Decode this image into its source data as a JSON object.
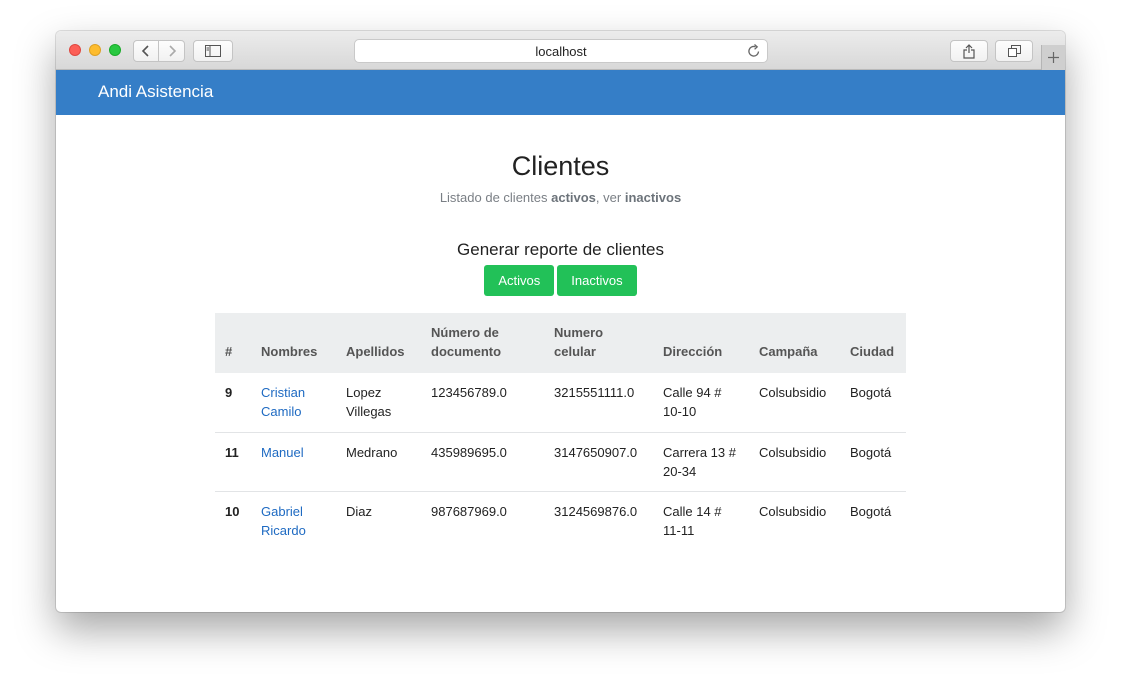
{
  "browser": {
    "url": "localhost"
  },
  "navbar": {
    "brand": "Andi Asistencia",
    "color": "#357ec7"
  },
  "page": {
    "title": "Clientes",
    "subtitle_prefix": "Listado de clientes ",
    "subtitle_active": "activos",
    "subtitle_mid": ", ver ",
    "subtitle_inactive": "inactivos",
    "report_heading": "Generar reporte de clientes",
    "btn_active": "Activos",
    "btn_inactive": "Inactivos",
    "button_color": "#22c158"
  },
  "table": {
    "headers": [
      "#",
      "Nombres",
      "Apellidos",
      "Número de documento",
      "Numero celular",
      "Dirección",
      "Campaña",
      "Ciudad"
    ],
    "rows": [
      {
        "id": "9",
        "nombres": "Cristian Camilo",
        "apellidos": "Lopez Villegas",
        "documento": "123456789.0",
        "celular": "3215551111.0",
        "direccion": "Calle 94 # 10-10",
        "campana": "Colsubsidio",
        "ciudad": "Bogotá"
      },
      {
        "id": "11",
        "nombres": "Manuel",
        "apellidos": "Medrano",
        "documento": "435989695.0",
        "celular": "3147650907.0",
        "direccion": "Carrera 13 # 20-34",
        "campana": "Colsubsidio",
        "ciudad": "Bogotá"
      },
      {
        "id": "10",
        "nombres": "Gabriel Ricardo",
        "apellidos": "Diaz",
        "documento": "987687969.0",
        "celular": "3124569876.0",
        "direccion": "Calle 14 # 11-11",
        "campana": "Colsubsidio",
        "ciudad": "Bogotá"
      }
    ]
  }
}
